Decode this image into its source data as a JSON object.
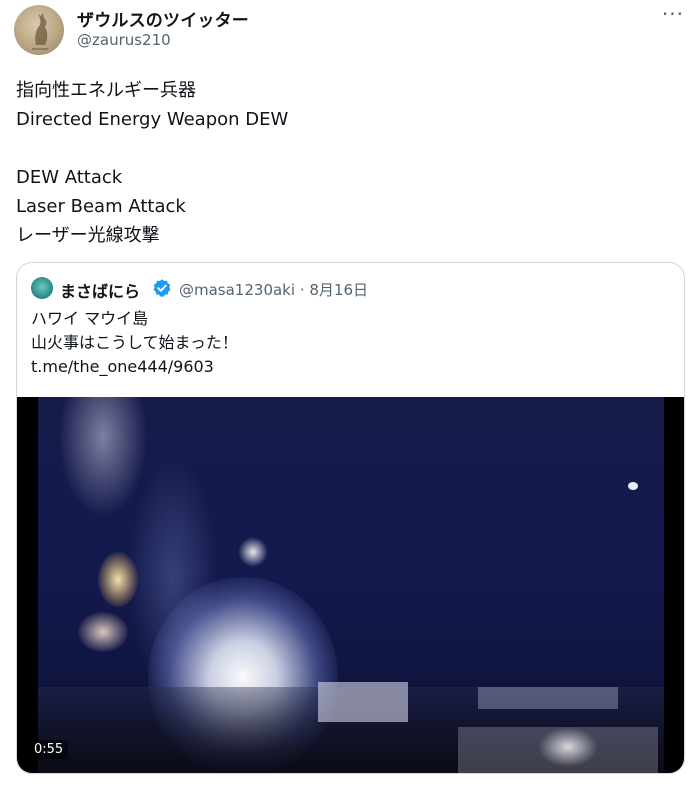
{
  "author": {
    "display_name": "ザウルスのツイッター",
    "handle": "@zaurus210",
    "avatar_icon": "kangaroo-avatar"
  },
  "more_icon": "···",
  "tweet": {
    "text": "指向性エネルギー兵器\nDirected Energy Weapon DEW\n\nDEW Attack\nLaser Beam Attack\nレーザー光線攻撃"
  },
  "quote": {
    "display_name": "まさばにら",
    "verified": true,
    "handle": "@masa1230aki",
    "separator": "·",
    "date": "8月16日",
    "text": "ハワイ マウイ島\n山火事はこうして始まった！",
    "link": "t.me/the_one444/9603",
    "video": {
      "duration": "0:55"
    }
  },
  "colors": {
    "verified_blue": "#1d9bf0",
    "secondary_text": "#536471",
    "border": "#cfd9de"
  }
}
